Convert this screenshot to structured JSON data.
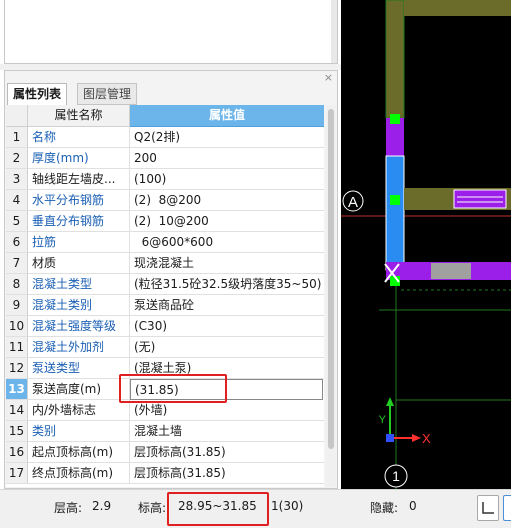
{
  "panel": {
    "tab_active": "属性列表",
    "tab_inactive": "图层管理",
    "close_glyph": "×"
  },
  "grid": {
    "header_name": "属性名称",
    "header_value": "属性值",
    "rows": [
      {
        "n": "1",
        "k": "名称",
        "v": "Q2(2排)"
      },
      {
        "n": "2",
        "k": "厚度(mm)",
        "v": "200"
      },
      {
        "n": "3",
        "k": "轴线距左墙皮...",
        "v": "(100)"
      },
      {
        "n": "4",
        "k": "水平分布钢筋",
        "v": "(2)  8@200"
      },
      {
        "n": "5",
        "k": "垂直分布钢筋",
        "v": "(2)  10@200"
      },
      {
        "n": "6",
        "k": "拉筋",
        "v": "  6@600*600"
      },
      {
        "n": "7",
        "k": "材质",
        "v": "现浇混凝土"
      },
      {
        "n": "8",
        "k": "混凝土类型",
        "v": "(粒径31.5砼32.5级坍落度35~50)"
      },
      {
        "n": "9",
        "k": "混凝土类别",
        "v": "泵送商品砼"
      },
      {
        "n": "10",
        "k": "混凝土强度等级",
        "v": "(C30)"
      },
      {
        "n": "11",
        "k": "混凝土外加剂",
        "v": "(无)"
      },
      {
        "n": "12",
        "k": "泵送类型",
        "v": "(混凝土泵)"
      },
      {
        "n": "13",
        "k": "泵送高度(m)",
        "v": "(31.85)"
      },
      {
        "n": "14",
        "k": "内/外墙标志",
        "v": "(外墙)"
      },
      {
        "n": "15",
        "k": "类别",
        "v": "混凝土墙"
      },
      {
        "n": "16",
        "k": "起点顶标高(m)",
        "v": "层顶标高(31.85)"
      },
      {
        "n": "17",
        "k": "终点顶标高(m)",
        "v": "层顶标高(31.85)"
      }
    ]
  },
  "canvas": {
    "axis_a": "A",
    "axis_1": "1",
    "x_label": "X",
    "y_label": "Y"
  },
  "status": {
    "floor_height_label": "层高:",
    "floor_height_value": "2.9",
    "elevation_label": "标高:",
    "elevation_value": "28.95~31.85",
    "extra_value": "1(30)",
    "hidden_label": "隐藏:",
    "hidden_value": "0"
  },
  "colors": {
    "header_blue": "#6cb5ea",
    "highlight_red": "#e02020",
    "wall_purple": "#9b1fe8",
    "wall_olive": "#6b6b2a",
    "wall_blue": "#2a8cf0",
    "grid_green": "#1f7a1f",
    "node_green": "#00ff00"
  }
}
